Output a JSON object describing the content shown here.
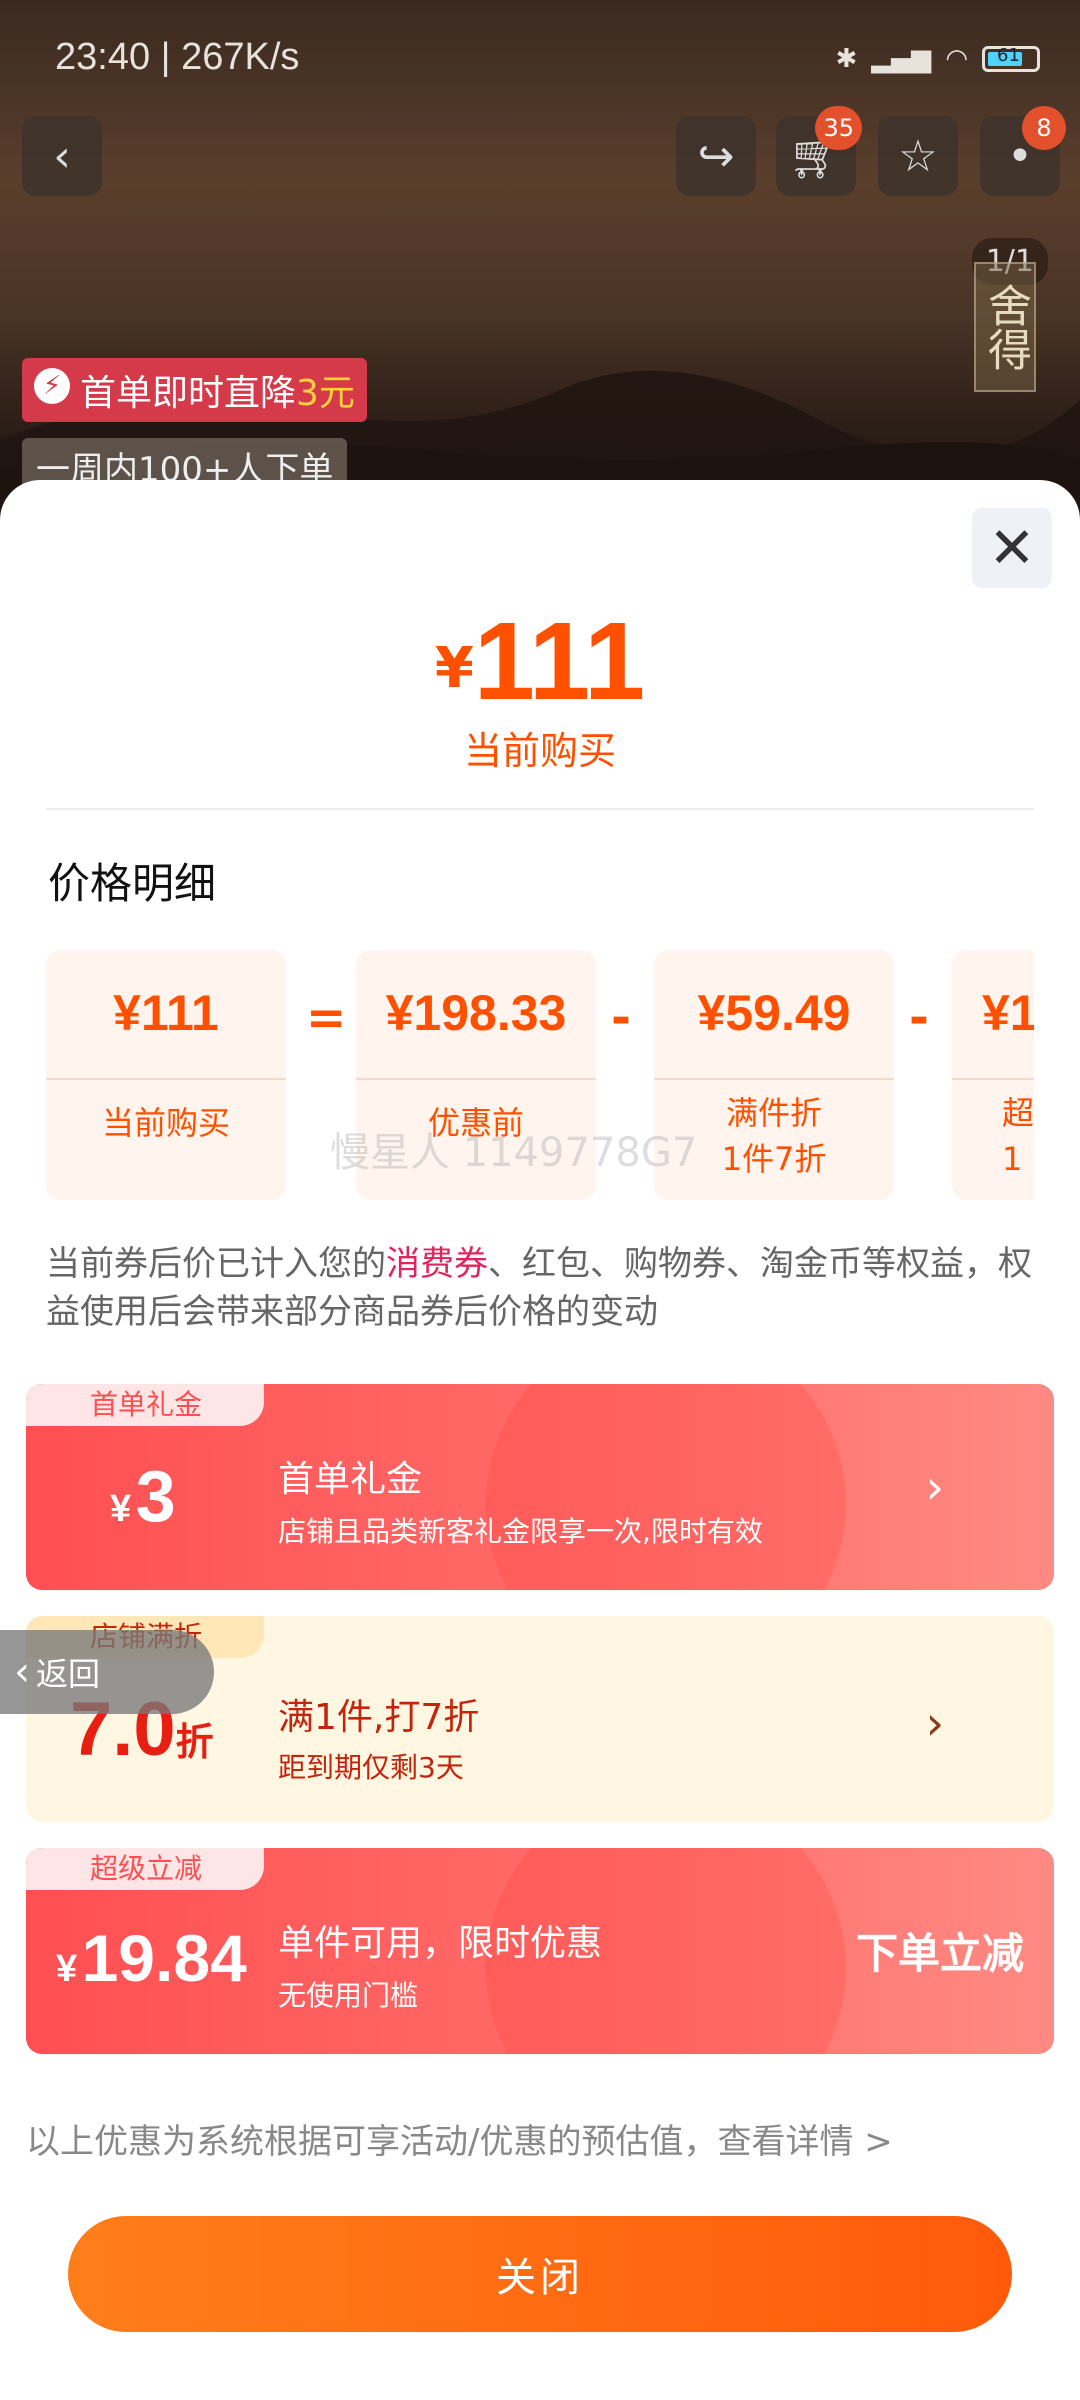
{
  "status_bar": {
    "time": "23:40 | 267K/s",
    "battery": "61"
  },
  "top_bar": {
    "cart_count": "35",
    "more_count": "8"
  },
  "product_image": {
    "pager": "1/1",
    "seal_text": "舍得"
  },
  "promo": {
    "prefix": "首单即时直降",
    "amount": "3元",
    "sales": "一周内100+人下单"
  },
  "sheet": {
    "price_yen": "¥",
    "price_value": "111",
    "price_label": "当前购买",
    "section_title": "价格明细",
    "breakdown": [
      {
        "value": "¥111",
        "label": "当前购买"
      },
      {
        "op": "=",
        "value": "¥198.33",
        "label": "优惠前"
      },
      {
        "op": "-",
        "value": "¥59.49",
        "label": "满件折\n1件7折"
      },
      {
        "op": "-",
        "value": "¥1",
        "label": "超\n1"
      }
    ],
    "watermark": "慢星人 1149778G7",
    "note_prefix": "当前券后价已计入您的",
    "note_highlight": "消费券",
    "note_suffix": "、红包、购物券、淘金币等权益，权益使用后会带来部分商品券后价格的变动",
    "coupons": [
      {
        "tag": "首单礼金",
        "yen": "¥",
        "amount": "3",
        "title": "首单礼金",
        "desc": "店铺且品类新客礼金限享一次,限时有效",
        "action": "›"
      },
      {
        "tag": "店铺满折",
        "amount": "7.0",
        "unit": "折",
        "title": "满1件,打7折",
        "desc": "距到期仅剩3天",
        "action": "›"
      },
      {
        "tag": "超级立减",
        "yen": "¥",
        "amount": "19.84",
        "title": "单件可用，限时优惠",
        "desc": "无使用门槛",
        "action": "下单立减"
      }
    ],
    "back_label": "返回",
    "footer_note": "以上优惠为系统根据可享活动/优惠的预估值，查看详情 >",
    "close_button": "关闭"
  },
  "colors": {
    "accent": "#ff5000",
    "coupon_red": "#ff4f52",
    "coupon_yellow": "#fff7e2",
    "highlight": "#e0245e"
  }
}
